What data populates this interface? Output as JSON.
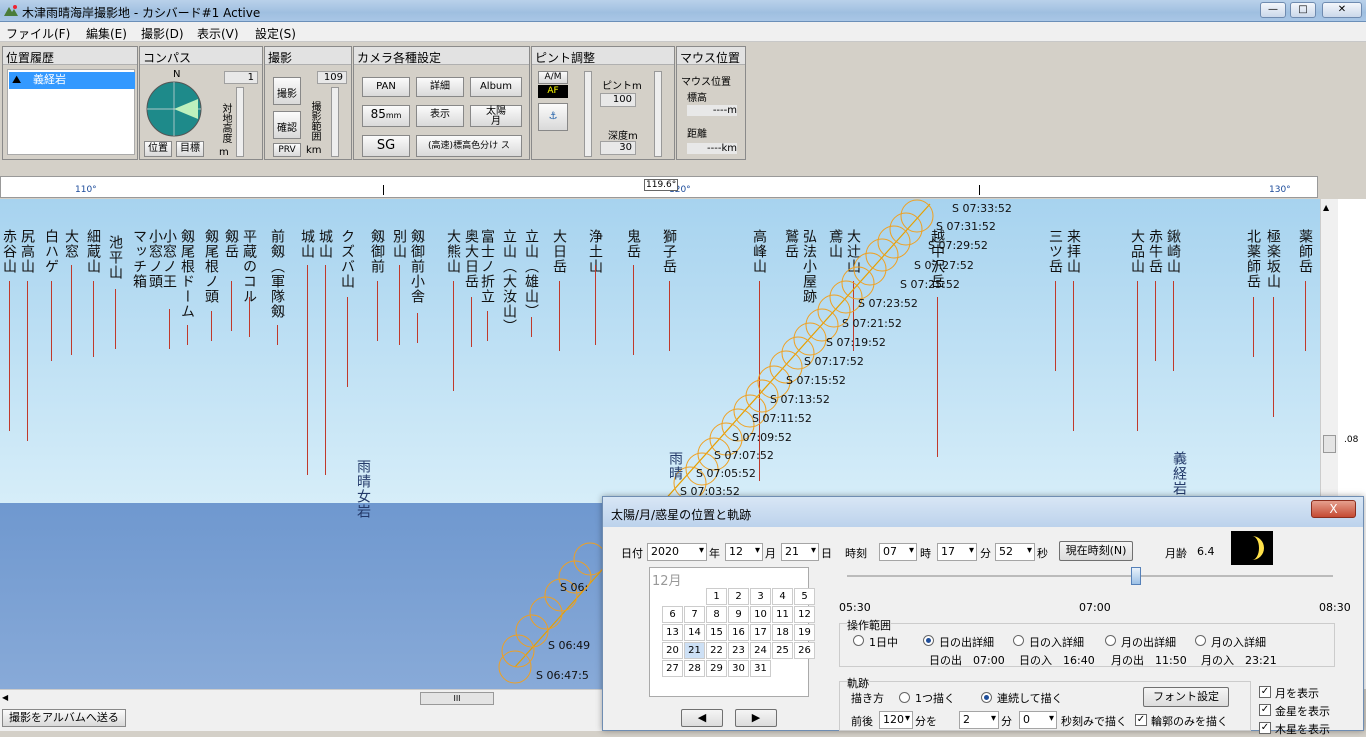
{
  "window": {
    "title": "木津雨晴海岸撮影地 - カシバード#1 Active",
    "min": "—",
    "max": "□",
    "close": "✕"
  },
  "menu": [
    "ファイル(F)",
    "編集(E)",
    "撮影(D)",
    "表示(V)",
    "設定(S)"
  ],
  "panels": {
    "history": {
      "title": "位置履歴",
      "item": "義経岩"
    },
    "compass": {
      "title": "コンパス",
      "north": "N",
      "value": "1",
      "vlabel": "対地高度",
      "unit": "m",
      "btn_pos": "位置",
      "btn_target": "目標"
    },
    "shoot": {
      "title": "撮影",
      "value": "109",
      "btn_shoot": "撮影",
      "btn_check": "確認",
      "btn_prv": "PRV",
      "vlabel": "撮影範囲",
      "unit": "km"
    },
    "camera": {
      "title": "カメラ各種設定",
      "pan": "PAN",
      "detail": "詳細",
      "album": "Album",
      "lens": "85",
      "lens_unit": "mm",
      "display": "表示",
      "sunmoon_top": "太陽",
      "sunmoon_bottom": "月",
      "sg": "SG",
      "colors": "(高速)標高色分け ス"
    },
    "focus": {
      "title": "ピント調整",
      "am": "A/M",
      "af": "AF",
      "focus_label": "ピントm",
      "focus_val": "100",
      "depth_label": "深度m",
      "depth_val": "30"
    },
    "mouse": {
      "title": "マウス位置",
      "label1": "マウス位置",
      "elev": "標高",
      "elev_unit": "----m",
      "dist": "距離",
      "dist_unit": "----km"
    }
  },
  "ruler": {
    "t110": "110°",
    "t120": "120°",
    "t130": "130°",
    "marker": "119.6°"
  },
  "peaks": [
    "赤谷山",
    "尻高山",
    "白ハゲ",
    "大窓",
    "細蔵山",
    "池平山",
    "マッチ箱",
    "小窓ノ頭",
    "小窓ノ王",
    "剱尾根ドーム",
    "剱尾根ノ頭",
    "剱岳",
    "平蔵のコル",
    "前剱（軍隊剱",
    "城山",
    "城山",
    "クズバ山",
    "剱御前",
    "別山",
    "剱御前小舎",
    "大熊山",
    "奥大日岳",
    "富士ノ折立",
    "立山（大汝山）",
    "立山（雄山）",
    "大日岳",
    "浄土山",
    "鬼岳",
    "獅子岳",
    "高峰山",
    "鷲岳",
    "弘法小屋跡",
    "鳶山",
    "大辻山",
    "越中沢岳",
    "三ツ岳",
    "来拝山",
    "大品山",
    "赤牛岳",
    "鍬崎山",
    "北薬師岳",
    "極楽坂山",
    "薬師岳"
  ],
  "sun_times": [
    "S 07:33:52",
    "S 07:31:52",
    "S 07:29:52",
    "S 07:27:52",
    "S 07:25:52",
    "S 07:23:52",
    "S 07:21:52",
    "S 07:19:52",
    "S 07:17:52",
    "S 07:15:52",
    "S 07:13:52",
    "S 07:11:52",
    "S 07:09:52",
    "S 07:07:52",
    "S 07:05:52",
    "S 07:03:52"
  ],
  "sun_times_low": [
    "S 06:",
    "S 06:49",
    "S 06:47:5"
  ],
  "overlay_labels": {
    "amaharashi": "雨晴女岩",
    "amaharashi2": "雨晴",
    "yoshitsune": "義経岩",
    "side": ".08"
  },
  "hscroll_thumb": "III",
  "status": "撮影をアルバムへ送る",
  "dialog": {
    "title": "太陽/月/惑星の位置と軌跡",
    "close": "X",
    "date_label": "日付",
    "year": "2020",
    "year_u": "年",
    "month": "12",
    "month_u": "月",
    "day": "21",
    "day_u": "日",
    "time_label": "時刻",
    "hour": "07",
    "hour_u": "時",
    "min": "17",
    "min_u": "分",
    "sec": "52",
    "sec_u": "秒",
    "now_btn": "現在時刻(N)",
    "moon_age_label": "月齢",
    "moon_age": "6.4",
    "cal_month": "12月",
    "cal_rows": [
      [
        "",
        "1",
        "2",
        "3",
        "4",
        "5"
      ],
      [
        "6",
        "7",
        "8",
        "9",
        "10",
        "11",
        "12"
      ],
      [
        "13",
        "14",
        "15",
        "16",
        "17",
        "18",
        "19"
      ],
      [
        "20",
        "21",
        "22",
        "23",
        "24",
        "25",
        "26"
      ],
      [
        "27",
        "28",
        "29",
        "30",
        "31",
        "",
        ""
      ]
    ],
    "slider_start": "05:30",
    "slider_mid": "07:00",
    "slider_end": "08:30",
    "op_label": "操作範囲",
    "op1": "1日中",
    "op2": "日の出詳細",
    "op3": "日の入詳細",
    "op4": "月の出詳細",
    "op5": "月の入詳細",
    "sunrise": "日の出　07:00",
    "sunset": "日の入　16:40",
    "moonrise": "月の出　11:50",
    "moonset": "月の入　23:21",
    "track_label": "軌跡",
    "draw_label": "描き方",
    "draw1": "1つ描く",
    "draw2": "連続して描く",
    "font_btn": "フォント設定",
    "range_label": "前後",
    "range_val": "120",
    "range_u": "分を",
    "step_val": "2",
    "step_u": "分",
    "sec_val": "0",
    "sec_u2": "秒刻みで描く",
    "outline": "輪郭のみを描く",
    "show_moon": "月を表示",
    "show_planets": "金星を表示",
    "show_more": "木星を表示",
    "nav_prev": "◀",
    "nav_next": "▶"
  },
  "colors": {
    "sky": "#b7ddf0",
    "sea": "#7aa3d4",
    "sun": "#f0a020",
    "track": "#e6a000"
  }
}
